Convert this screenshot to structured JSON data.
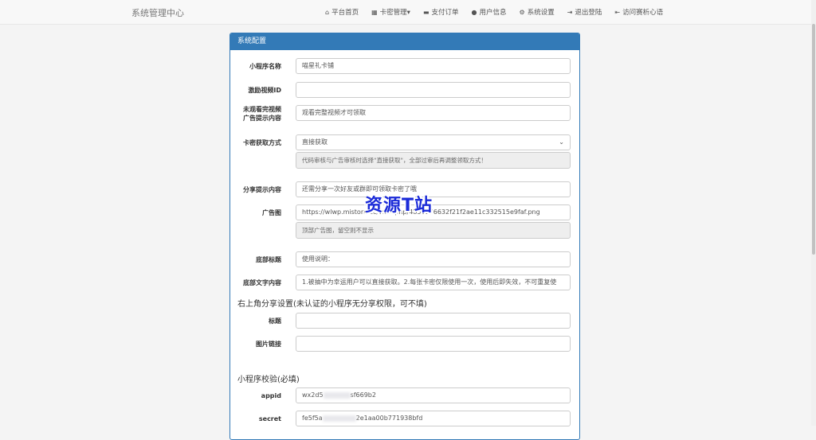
{
  "navbar": {
    "brand": "系统管理中心",
    "items": [
      {
        "icon": "home-icon",
        "glyph": "⌂",
        "label": "平台首页"
      },
      {
        "icon": "grid-icon",
        "glyph": "▦",
        "label": "卡密管理▾"
      },
      {
        "icon": "card-icon",
        "glyph": "▬",
        "label": "支付订单"
      },
      {
        "icon": "user-icon",
        "glyph": "●",
        "label": "用户信息"
      },
      {
        "icon": "gear-icon",
        "glyph": "⚙",
        "label": "系统设置"
      },
      {
        "icon": "logout-icon",
        "glyph": "⇥",
        "label": "退出登陆"
      },
      {
        "icon": "login-icon",
        "glyph": "⇤",
        "label": "访问赛析心语"
      }
    ]
  },
  "panel": {
    "title": "系统配置",
    "fields": {
      "app_name": {
        "label": "小程序名称",
        "value": "喵星礼卡铺"
      },
      "video_id": {
        "label": "激励视频ID",
        "value": ""
      },
      "ad_tip": {
        "label_line1": "未观看完视频",
        "label_line2": "广告提示内容",
        "value": "观看完整视频才可领取"
      },
      "get_mode": {
        "label": "卡密获取方式",
        "value": "直接获取",
        "help": "代码审核与广告审核时选择\"直接获取\"，全部过审后再调整领取方式！"
      },
      "share_tip": {
        "label": "分享提示内容",
        "value": "还需分享一次好友或群即可领取卡密了哦"
      },
      "ad_image": {
        "label": "广告图",
        "value": "https://wlwp.mistora.cc/view.php/4856176632f21f2ae11c332515e9faf.png",
        "help": "顶部广告图，留空则不显示"
      },
      "footer_title": {
        "label": "底部标题",
        "value": "使用说明："
      },
      "footer_text": {
        "label": "底部文字内容",
        "value": "1.被抽中为幸运用户可以直接获取。2.每张卡密仅限使用一次，使用后即失效，不可重复使"
      }
    },
    "share_section": {
      "title": "右上角分享设置(未认证的小程序无分享权限，可不填)",
      "title_label": "标题",
      "title_value": "",
      "image_label": "图片链接",
      "image_value": ""
    },
    "verify_section": {
      "title": "小程序校验(必填)",
      "appid_label": "appid",
      "appid_prefix": "wx2d5",
      "appid_suffix": "sf669b2",
      "secret_label": "secret",
      "secret_prefix": "fe5f5a",
      "secret_suffix": "2e1aa00b771938bfd"
    }
  },
  "watermark": "资源T站"
}
